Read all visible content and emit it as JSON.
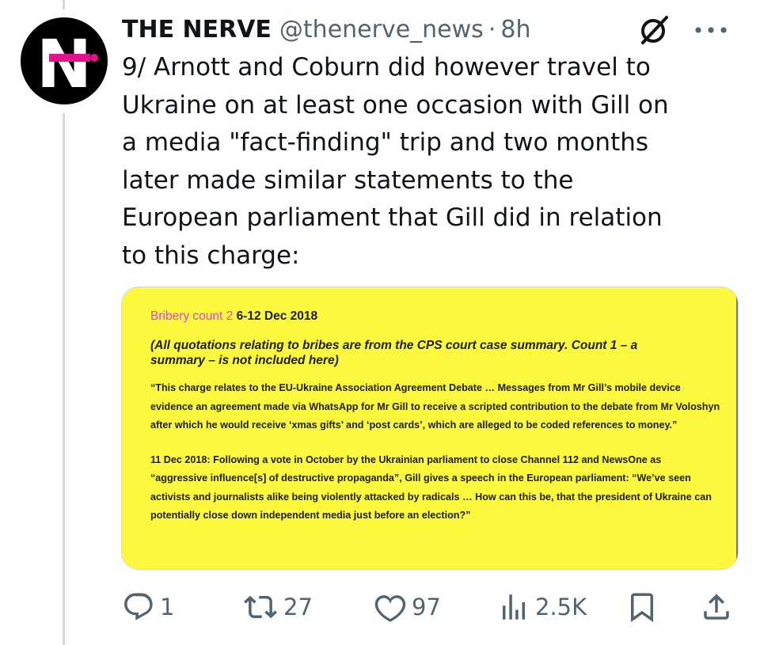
{
  "tweet": {
    "author_name": "THE NERVE",
    "author_handle": "@thenerve_news",
    "separator": "·",
    "time": "8h",
    "text": "9/ Arnott and Coburn did however travel to\nUkraine on at least one occasion with Gill on\na media \"fact-finding\" trip and two months\nlater made similar statements to the\nEuropean parliament that Gill did in relation\nto this charge:",
    "avatar_letter": "N"
  },
  "media": {
    "title_label": "Bribery count 2",
    "title_date": "6-12 Dec 2018",
    "note": "(All quotations relating to bribes are from the CPS court case summary. Count 1  –  a summary – is not included here)",
    "para1": "“This charge relates to the EU-Ukraine Association Agreement Debate … Messages from Mr Gill’s mobile device evidence an agreement made via WhatsApp for Mr Gill to receive a scripted contribution to the debate from Mr Voloshyn after which he would receive ‘xmas gifts’ and ‘post cards’, which are alleged to be coded references to money.”",
    "para2": "11 Dec 2018: Following a vote in October by the Ukrainian parliament to close Channel 112 and NewsOne as “aggressive influence[s] of destructive propaganda”, Gill gives a speech in the European parliament: “We’ve seen activists and journalists alike being violently attacked by radicals … How can this be, that the president of Ukraine can potentially close down independent media just before an election?”"
  },
  "actions": {
    "replies": "1",
    "reposts": "27",
    "likes": "97",
    "views": "2.5K"
  },
  "icons": {
    "reply": "reply-icon",
    "repost": "repost-icon",
    "like": "heart-icon",
    "views": "views-chart-icon",
    "bookmark": "bookmark-icon",
    "share": "share-icon",
    "grok": "grok-icon",
    "more": "more-icon"
  },
  "colors": {
    "text": "#0f1419",
    "secondary": "#536471",
    "border": "#cfd9de",
    "brand_pink": "#e0138c",
    "media_background": "#fcf83d",
    "media_label": "#d94ad1"
  }
}
